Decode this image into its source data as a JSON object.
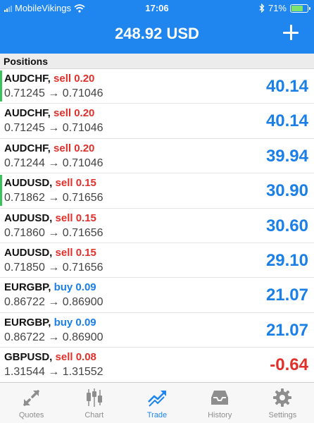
{
  "status": {
    "carrier": "MobileVikings",
    "time": "17:06",
    "battery": "71%",
    "battery_level": 0.71
  },
  "header": {
    "title": "248.92 USD",
    "add_icon": "plus-icon"
  },
  "section_label": "Positions",
  "positions": [
    {
      "symbol": "AUDCHF,",
      "side": "sell",
      "side_label": "sell 0.20",
      "prices": "0.71245 → 0.71046",
      "profit": "40.14",
      "profit_sign": "pos",
      "marker": true
    },
    {
      "symbol": "AUDCHF,",
      "side": "sell",
      "side_label": "sell 0.20",
      "prices": "0.71245 → 0.71046",
      "profit": "40.14",
      "profit_sign": "pos",
      "marker": false
    },
    {
      "symbol": "AUDCHF,",
      "side": "sell",
      "side_label": "sell 0.20",
      "prices": "0.71244 → 0.71046",
      "profit": "39.94",
      "profit_sign": "pos",
      "marker": false
    },
    {
      "symbol": "AUDUSD,",
      "side": "sell",
      "side_label": "sell 0.15",
      "prices": "0.71862 → 0.71656",
      "profit": "30.90",
      "profit_sign": "pos",
      "marker": true
    },
    {
      "symbol": "AUDUSD,",
      "side": "sell",
      "side_label": "sell 0.15",
      "prices": "0.71860 → 0.71656",
      "profit": "30.60",
      "profit_sign": "pos",
      "marker": false
    },
    {
      "symbol": "AUDUSD,",
      "side": "sell",
      "side_label": "sell 0.15",
      "prices": "0.71850 → 0.71656",
      "profit": "29.10",
      "profit_sign": "pos",
      "marker": false
    },
    {
      "symbol": "EURGBP,",
      "side": "buy",
      "side_label": "buy 0.09",
      "prices": "0.86722 → 0.86900",
      "profit": "21.07",
      "profit_sign": "pos",
      "marker": false
    },
    {
      "symbol": "EURGBP,",
      "side": "buy",
      "side_label": "buy 0.09",
      "prices": "0.86722 → 0.86900",
      "profit": "21.07",
      "profit_sign": "pos",
      "marker": false
    },
    {
      "symbol": "GBPUSD,",
      "side": "sell",
      "side_label": "sell 0.08",
      "prices": "1.31544 → 1.31552",
      "profit": "-0.64",
      "profit_sign": "neg",
      "marker": false
    }
  ],
  "tabs": [
    {
      "label": "Quotes",
      "icon": "quotes-icon",
      "active": false
    },
    {
      "label": "Chart",
      "icon": "chart-icon",
      "active": false
    },
    {
      "label": "Trade",
      "icon": "trade-icon",
      "active": true
    },
    {
      "label": "History",
      "icon": "history-icon",
      "active": false
    },
    {
      "label": "Settings",
      "icon": "settings-icon",
      "active": false
    }
  ],
  "colors": {
    "accent": "#1f86f0",
    "profit_positive": "#1a7fe6",
    "profit_negative": "#e0302b",
    "marker": "#3cc25b",
    "tab_inactive": "#8e8e8e"
  }
}
